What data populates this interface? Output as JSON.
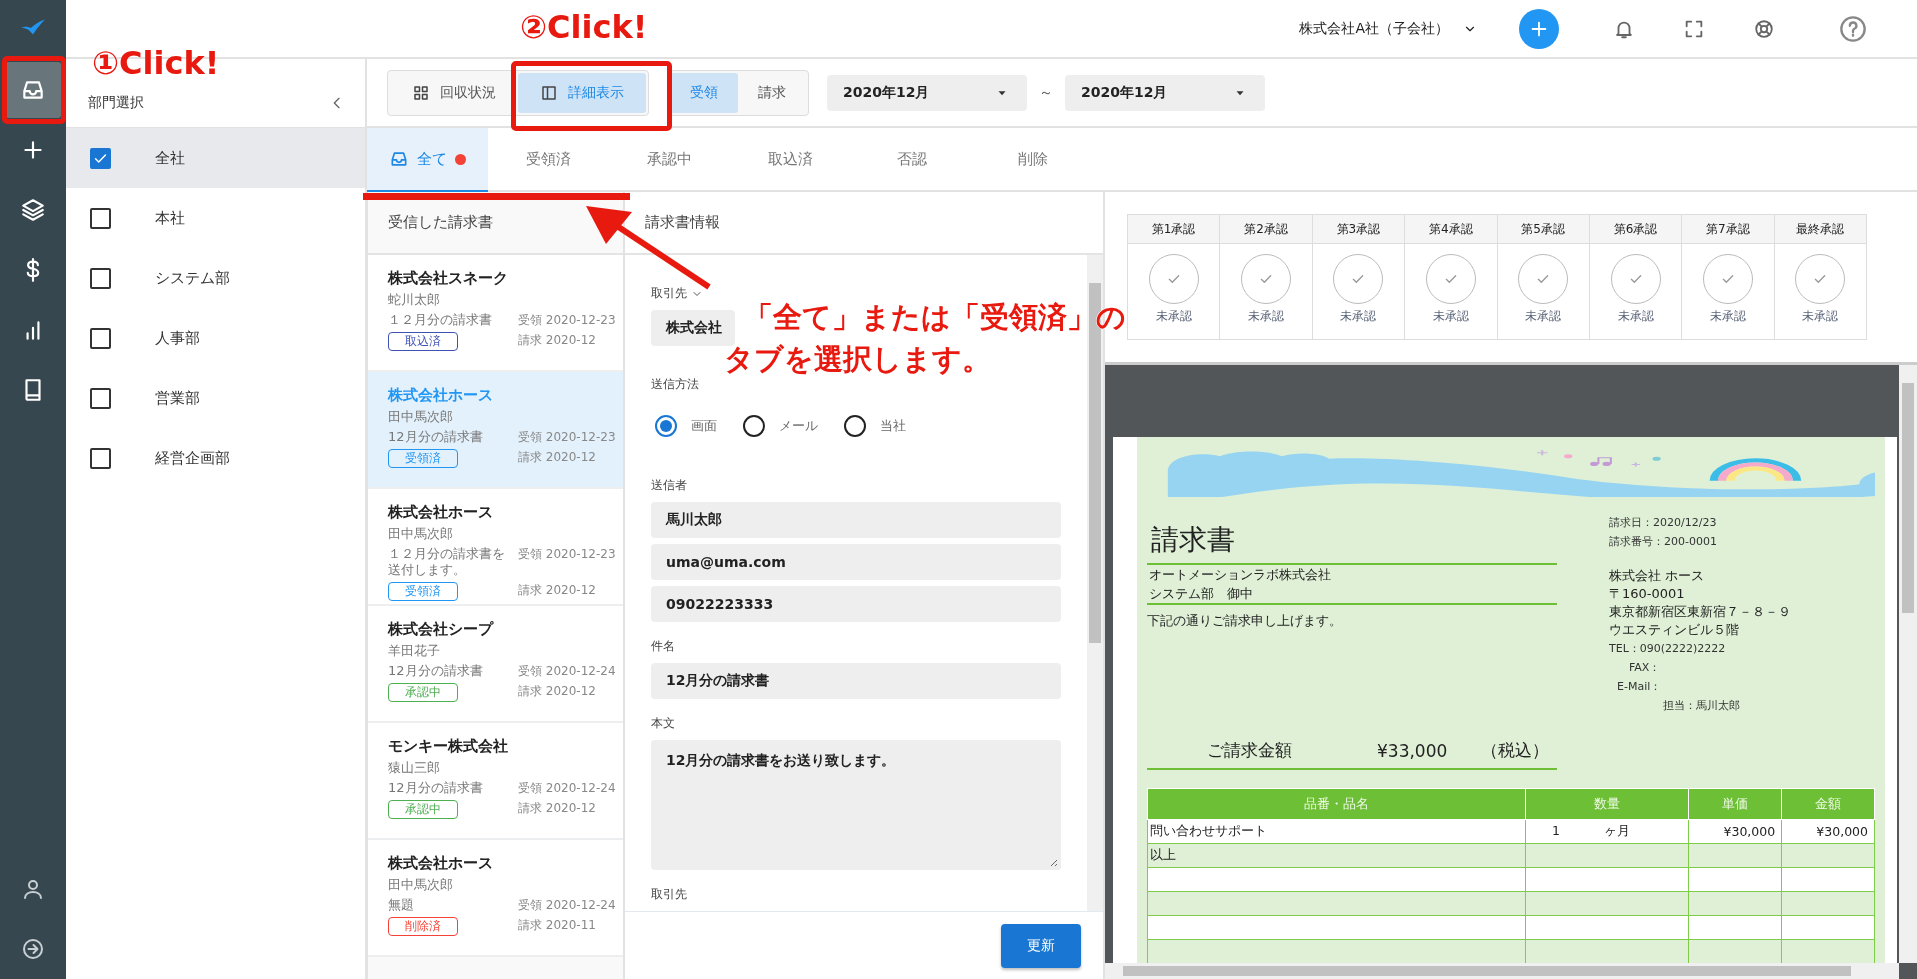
{
  "rail": {
    "items": [
      {
        "kind": "inbox",
        "selected": true
      },
      {
        "kind": "plus",
        "selected": false
      },
      {
        "kind": "layers",
        "selected": false
      },
      {
        "kind": "dollar",
        "selected": false
      },
      {
        "kind": "chart",
        "selected": false
      },
      {
        "kind": "book",
        "selected": false
      }
    ],
    "bottom": [
      {
        "kind": "user"
      },
      {
        "kind": "logout"
      }
    ]
  },
  "header": {
    "company": "株式会社A社（子会社）"
  },
  "departments": {
    "title": "部門選択",
    "items": [
      {
        "label": "全社",
        "checked": true,
        "selected": true
      },
      {
        "label": "本社",
        "checked": false,
        "selected": false
      },
      {
        "label": "システム部",
        "checked": false,
        "selected": false
      },
      {
        "label": "人事部",
        "checked": false,
        "selected": false
      },
      {
        "label": "営業部",
        "checked": false,
        "selected": false
      },
      {
        "label": "経営企画部",
        "checked": false,
        "selected": false
      }
    ]
  },
  "toolbar": {
    "views": [
      {
        "label": "回収状況",
        "kind": "grid",
        "selected": false
      },
      {
        "label": "詳細表示",
        "kind": "panel",
        "selected": true
      }
    ],
    "directions": [
      {
        "label": "受領",
        "selected": true
      },
      {
        "label": "請求",
        "selected": false
      }
    ],
    "date_from": "2020年12月",
    "range_sign": "～",
    "date_to": "2020年12月"
  },
  "tabs": [
    {
      "label": "全て",
      "kind": "inbox",
      "dot": true,
      "selected": true
    },
    {
      "label": "受領済",
      "kind": "plain",
      "dot": false,
      "selected": false
    },
    {
      "label": "承認中",
      "kind": "plain",
      "dot": false,
      "selected": false
    },
    {
      "label": "取込済",
      "kind": "plain",
      "dot": false,
      "selected": false
    },
    {
      "label": "否認",
      "kind": "plain",
      "dot": false,
      "selected": false
    },
    {
      "label": "削除",
      "kind": "plain",
      "dot": false,
      "selected": false
    }
  ],
  "list": {
    "title": "受信した請求書",
    "items": [
      {
        "company": "株式会社スネーク",
        "person": "蛇川太郎",
        "subject": "１２月分の請求書",
        "received": "受領 2020-12-23",
        "billed": "請求 2020-12",
        "status": "取込済",
        "color": "#3f51b5",
        "selected": false
      },
      {
        "company": "株式会社ホース",
        "person": "田中馬次郎",
        "subject": "12月分の請求書",
        "received": "受領 2020-12-23",
        "billed": "請求 2020-12",
        "status": "受領済",
        "color": "#2196f3",
        "selected": true
      },
      {
        "company": "株式会社ホース",
        "person": "田中馬次郎",
        "subject": "１２月分の請求書を送付します。",
        "received": "受領 2020-12-23",
        "billed": "請求 2020-12",
        "status": "受領済",
        "color": "#2196f3",
        "selected": false
      },
      {
        "company": "株式会社シープ",
        "person": "羊田花子",
        "subject": "12月分の請求書",
        "received": "受領 2020-12-24",
        "billed": "請求 2020-12",
        "status": "承認中",
        "color": "#4caf50",
        "selected": false
      },
      {
        "company": "モンキー株式会社",
        "person": "猿山三郎",
        "subject": "12月分の請求書",
        "received": "受領 2020-12-24",
        "billed": "請求 2020-12",
        "status": "承認中",
        "color": "#4caf50",
        "selected": false
      },
      {
        "company": "株式会社ホース",
        "person": "田中馬次郎",
        "subject": "無題",
        "received": "受領 2020-12-24",
        "billed": "請求 2020-11",
        "status": "削除済",
        "color": "#f44336",
        "selected": false
      }
    ]
  },
  "form": {
    "title": "請求書情報",
    "fields": [
      {
        "kind": "select",
        "label": "取引先",
        "value": "株式会社"
      },
      {
        "kind": "radio",
        "label": "送信方法",
        "options": [
          {
            "label": "画面",
            "selected": true
          },
          {
            "label": "メール",
            "selected": false
          },
          {
            "label": "当社",
            "selected": false
          }
        ]
      },
      {
        "kind": "inputs",
        "label": "送信者",
        "values": [
          "馬川太郎",
          "uma@uma.com",
          "09022223333"
        ]
      },
      {
        "kind": "inputs",
        "label": "件名",
        "values": [
          "12月分の請求書"
        ]
      },
      {
        "kind": "textarea",
        "label": "本文",
        "value": "12月分の請求書をお送り致します。"
      },
      {
        "kind": "heading",
        "label": "取引先"
      }
    ],
    "submit": "更新"
  },
  "approvals": [
    {
      "label": "第1承認",
      "status": "未承認",
      "approved": false
    },
    {
      "label": "第2承認",
      "status": "未承認",
      "approved": false
    },
    {
      "label": "第3承認",
      "status": "未承認",
      "approved": false
    },
    {
      "label": "第4承認",
      "status": "未承認",
      "approved": false
    },
    {
      "label": "第5承認",
      "status": "未承認",
      "approved": false
    },
    {
      "label": "第6承認",
      "status": "未承認",
      "approved": false
    },
    {
      "label": "第7承認",
      "status": "未承認",
      "approved": false
    },
    {
      "label": "最終承認",
      "status": "未承認",
      "approved": false
    }
  ],
  "invoice": {
    "title": "請求書",
    "meta": [
      "請求日：2020/12/23",
      "請求番号：200-0001"
    ],
    "recipient": [
      "オートメーションラボ株式会社",
      "システム部　御中"
    ],
    "note": "下記の通りご請求申し上げます。",
    "sender": [
      "株式会社 ホース",
      "〒160-0001",
      "東京都新宿区東新宿７－８－９",
      "ウエスティンビル５階"
    ],
    "contact": [
      "TEL：090(2222)2222",
      "FAX：",
      "E-Mail：",
      "担当：馬川太郎"
    ],
    "total_label": "ご請求金額",
    "total": "¥33,000",
    "tax": "（税込）",
    "columns": [
      "品番・品名",
      "数量",
      "単価",
      "金額"
    ],
    "rows": [
      {
        "name": "問い合わせサポート",
        "qty": "1",
        "unit": "ヶ月",
        "price": "¥30,000",
        "amount": "¥30,000"
      },
      {
        "name": "以上"
      }
    ]
  },
  "annotations": [
    {
      "kind": "step",
      "text": "①Click!"
    },
    {
      "kind": "step",
      "text": "②Click!"
    },
    {
      "kind": "instruction",
      "text": "「全て」または「受領済」の"
    },
    {
      "kind": "instruction",
      "text": "タブを選択します。"
    }
  ]
}
